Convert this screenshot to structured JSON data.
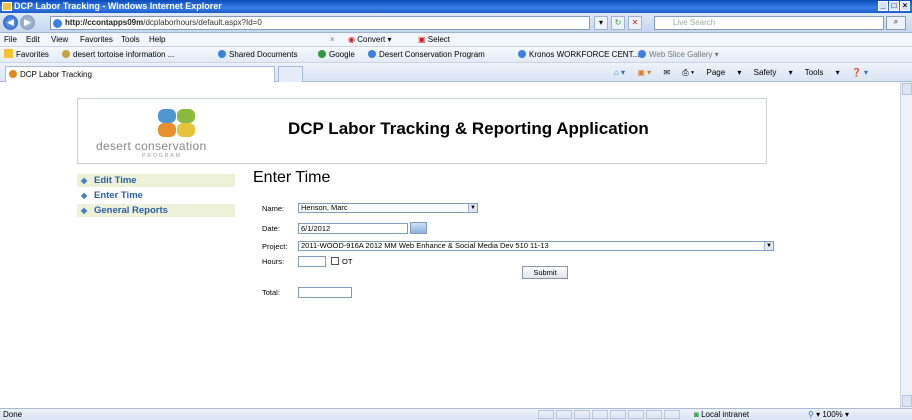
{
  "window": {
    "title": "DCP Labor Tracking - Windows Internet Explorer"
  },
  "address": {
    "host": "http://ccontapps09m",
    "path": "/dcplaborhours/default.aspx?Id=0",
    "search_placeholder": "Live Search"
  },
  "menubar": {
    "items": [
      "File",
      "Edit",
      "View",
      "Favorites",
      "Tools",
      "Help"
    ],
    "convert": "Convert",
    "select": "Select"
  },
  "favorites": {
    "label": "Favorites",
    "items": [
      "desert tortoise information ...",
      "Shared Documents",
      "Google",
      "Desert Conservation Program",
      "Kronos WORKFORCE CENT...",
      "Web Slice Gallery"
    ]
  },
  "tab": {
    "title": "DCP Labor Tracking"
  },
  "commands": [
    "Page",
    "Safety",
    "Tools"
  ],
  "status": {
    "left": "Done",
    "zone": "Local intranet",
    "zoom": "100%"
  },
  "header": {
    "logo_text": "desert conservation",
    "logo_sub": "PROGRAM",
    "app_title": "DCP Labor Tracking & Reporting Application"
  },
  "nav": {
    "items": [
      "Edit Time",
      "Enter Time",
      "General Reports"
    ]
  },
  "page": {
    "title": "Enter Time"
  },
  "form": {
    "name_label": "Name:",
    "name_value": "Henson, Marc",
    "date_label": "Date:",
    "date_value": "6/1/2012",
    "project_label": "Project:",
    "project_value": "2011-WOOD-916A 2012 MM Web Enhance & Social Media Dev 510 11-13",
    "hours_label": "Hours:",
    "ot_label": "OT",
    "submit_label": "Submit",
    "total_label": "Total:"
  },
  "colors": {
    "nav_text": "#2a5fa8",
    "nav_bg": "#ecf1d8",
    "titlebar": "#0b4bb8"
  }
}
